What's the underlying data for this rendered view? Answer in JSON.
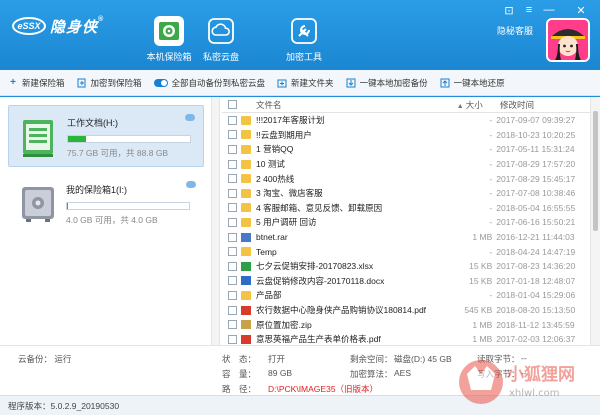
{
  "app": {
    "logo_badge": "eSSX",
    "logo_text": "隐身侠",
    "logo_reg": "®"
  },
  "nav_tabs": [
    {
      "label": "本机保险箱",
      "icon": "safe-icon",
      "active": true
    },
    {
      "label": "私密云盘",
      "icon": "cloud-icon",
      "active": false
    },
    {
      "label": "加密工具",
      "icon": "tools-icon",
      "active": false
    }
  ],
  "window_controls": {
    "shirt": "⊡",
    "menu": "≡",
    "minimize": "—",
    "close": "✕"
  },
  "header": {
    "service_link": "隐秘客服"
  },
  "toolbar": {
    "new_vault": "新建保险箱",
    "add_to_vault": "加密到保险箱",
    "auto_backup": "全部自动备份到私密云盘",
    "new_folder": "新建文件夹",
    "backup_local": "一键本地加密备份",
    "restore_local": "一键本地还原"
  },
  "vaults": [
    {
      "name": "工作文档(H:)",
      "info": "75.7 GB 可用，共 88.8 GB",
      "used_fraction": 0.15,
      "active": true
    },
    {
      "name": "我的保险箱1(I:)",
      "info": "4.0 GB 可用，共 4.0 GB",
      "used_fraction": 0.01,
      "active": false
    }
  ],
  "file_table": {
    "col_name": "文件名",
    "col_size": "大小",
    "col_date": "修改时间",
    "sort_arrow": "▲",
    "rows": [
      {
        "name": "!!!2017年客服计划",
        "size": "-",
        "date": "2017-09-07 09:39:27",
        "type": "folder"
      },
      {
        "name": "!!云盘到期用户",
        "size": "-",
        "date": "2018-10-23 10:20:25",
        "type": "folder"
      },
      {
        "name": "1 营销QQ",
        "size": "-",
        "date": "2017-05-11 15:31:24",
        "type": "folder"
      },
      {
        "name": "10 测试",
        "size": "-",
        "date": "2017-08-29 17:57:20",
        "type": "folder"
      },
      {
        "name": "2 400热线",
        "size": "-",
        "date": "2017-08-29 15:45:17",
        "type": "folder"
      },
      {
        "name": "3 淘宝、微店客服",
        "size": "-",
        "date": "2017-07-08 10:38:46",
        "type": "folder"
      },
      {
        "name": "4 客服邮箱、意见反馈、卸载原因",
        "size": "-",
        "date": "2018-05-04 16:55:55",
        "type": "folder"
      },
      {
        "name": "5 用户调研 回访",
        "size": "-",
        "date": "2017-06-16 15:50:21",
        "type": "folder"
      },
      {
        "name": "btnet.rar",
        "size": "1 MB",
        "date": "2016-12-21 11:44:03",
        "type": "rar"
      },
      {
        "name": "Temp",
        "size": "-",
        "date": "2018-04-24 14:47:19",
        "type": "folder"
      },
      {
        "name": "七夕云促销安排-20170823.xlsx",
        "size": "15 KB",
        "date": "2017-08-23 14:36:20",
        "type": "xlsx"
      },
      {
        "name": "云盘促销修改内容-20170118.docx",
        "size": "15 KB",
        "date": "2017-01-18 12:48:07",
        "type": "docx"
      },
      {
        "name": "产品部",
        "size": "-",
        "date": "2018-01-04 15:29:06",
        "type": "folder"
      },
      {
        "name": "农行数据中心隐身侠产品购销协议180814.pdf",
        "size": "545 KB",
        "date": "2018-08-20 15:13:50",
        "type": "pdf"
      },
      {
        "name": "原位置加密.zip",
        "size": "1 MB",
        "date": "2018-11-12 13:45:59",
        "type": "zip"
      },
      {
        "name": "意思英福产品生产表单价格表.pdf",
        "size": "1 MB",
        "date": "2017-02-03 12:06:37",
        "type": "pdf"
      }
    ]
  },
  "status": {
    "cloud_backup": "云备份：  运行",
    "state_label": "状　态：",
    "state_value": "打开",
    "capacity_label": "容　量：",
    "capacity_value": "89 GB",
    "path_label": "路　径：",
    "path_value": "D:\\PCK\\IMAGE35（旧版本）",
    "free_label": "剩余空间：",
    "free_value": "磁盘(D:) 45 GB",
    "algo_label": "加密算法：",
    "algo_value": "AES",
    "read_label": "读取字节：",
    "read_value": "--",
    "write_label": "写入字节：",
    "write_value": "--"
  },
  "footer": {
    "version": "程序版本：5.0.2.9_20190530"
  },
  "watermark": {
    "text": "小狐狸网",
    "url": "xhlwl.com"
  }
}
